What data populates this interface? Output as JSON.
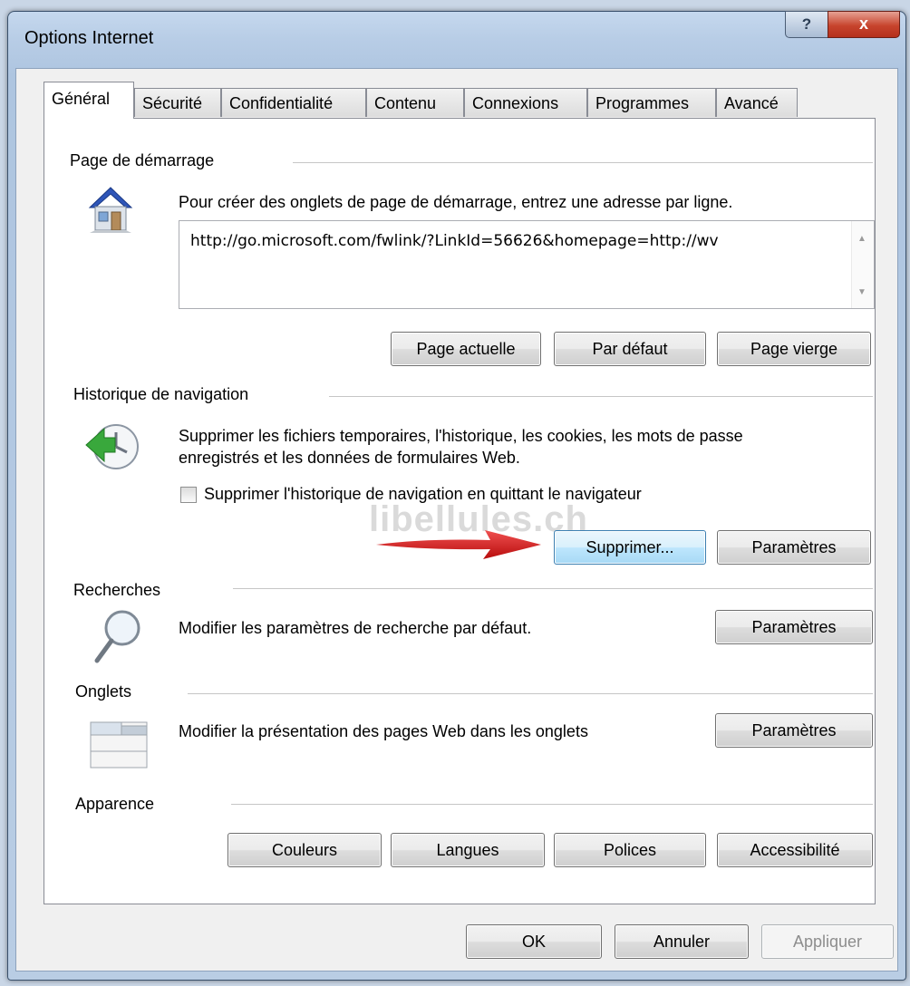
{
  "window": {
    "title": "Options Internet",
    "help_label": "?",
    "close_label": "x"
  },
  "tabs": [
    {
      "label": "Général",
      "active": true
    },
    {
      "label": "Sécurité"
    },
    {
      "label": "Confidentialité"
    },
    {
      "label": "Contenu"
    },
    {
      "label": "Connexions"
    },
    {
      "label": "Programmes"
    },
    {
      "label": "Avancé"
    }
  ],
  "home": {
    "title": "Page de démarrage",
    "description": "Pour créer des onglets de page de démarrage, entrez une adresse par ligne.",
    "url": "http://go.microsoft.com/fwlink/?LinkId=56626&homepage=http://wv",
    "btn_current": "Page actuelle",
    "btn_default": "Par défaut",
    "btn_blank": "Page vierge",
    "icon": "house-icon"
  },
  "history": {
    "title": "Historique de navigation",
    "description_line1": "Supprimer les fichiers temporaires, l'historique, les cookies, les mots de passe",
    "description_line2": "enregistrés et les données de formulaires Web.",
    "checkbox_label": "Supprimer l'historique de navigation en quittant le navigateur",
    "checkbox_checked": false,
    "btn_delete": "Supprimer...",
    "btn_settings": "Paramètres",
    "watermark": "libellules.ch",
    "icon": "history-clock-icon"
  },
  "search": {
    "title": "Recherches",
    "description": "Modifier les paramètres de recherche par défaut.",
    "btn_settings": "Paramètres",
    "icon": "magnifier-icon"
  },
  "tabs_section": {
    "title": "Onglets",
    "description": "Modifier la présentation des pages Web dans les onglets",
    "btn_settings": "Paramètres",
    "icon": "tabs-window-icon"
  },
  "appearance": {
    "title": "Apparence",
    "btn_colors": "Couleurs",
    "btn_languages": "Langues",
    "btn_fonts": "Polices",
    "btn_accessibility": "Accessibilité"
  },
  "footer": {
    "ok": "OK",
    "cancel": "Annuler",
    "apply": "Appliquer"
  }
}
